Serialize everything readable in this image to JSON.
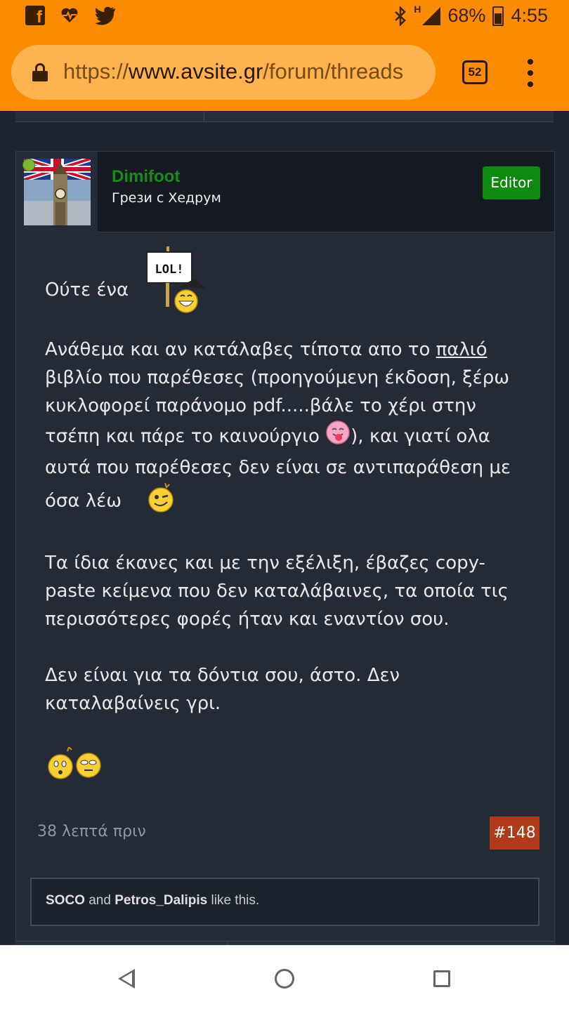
{
  "status_bar": {
    "battery": "68%",
    "time": "4:55",
    "network": "H",
    "icons": [
      "facebook-icon",
      "heart-pulse-icon",
      "twitter-icon",
      "bluetooth-icon",
      "signal-icon",
      "battery-icon"
    ]
  },
  "browser": {
    "url_protocol": "https://",
    "url_host": "www.avsite.gr",
    "url_path": "/forum/threads",
    "tab_count": "52"
  },
  "post": {
    "username": "Dimifoot",
    "user_title": "Грези с Хедрум",
    "role_badge": "Editor",
    "message": {
      "p1": "Ούτε ένα",
      "p2_before_link": "Ανάθεμα και αν κατάλαβες τίποτα απο το ",
      "p2_link": "παλιό",
      "p2_after_link": " βιβλίο που παρέθεσες (προηγούμενη έκδοση, ξέρω κυκλοφορεί παράνομο pdf.....βάλε το χέρι στην τσέπη και πάρε το καινούργιο ",
      "p2_after_smiley": "), και γιατί ολα αυτά που παρέθεσες δεν είναι σε αντιπαράθεση με όσα λέω",
      "p3": "Τα ίδια έκανες και με την εξέλιξη, έβαζες copy-paste κείμενα που δεν καταλάβαινες, τα οποία τις περισσότερες φορές ήταν και εναντίον σου.",
      "p4": "Δεν είναι για τα δόντια σου, άστο. Δεν καταλαβαίνεις γρι."
    },
    "sign_text": "LOL!",
    "date": "38 λεπτά πριν",
    "post_number": "#148",
    "likes": {
      "user1": "SOCO",
      "joiner": " and ",
      "user2": "Petros_Dalipis",
      "suffix": " like this."
    }
  },
  "colors": {
    "chrome_orange": "#fb8c00",
    "page_bg": "#1f2530",
    "username_green": "#1a8a1a",
    "editor_badge": "#0f8a10",
    "post_number_badge": "#b13a1c"
  }
}
